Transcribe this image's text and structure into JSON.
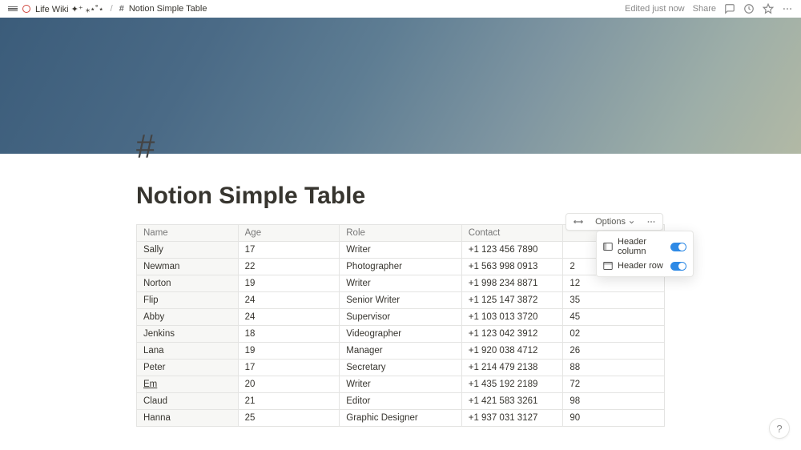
{
  "topbar": {
    "workspace": "Life Wiki ✦⁺ ⁎⋆˚⋆",
    "page": "Notion Simple Table",
    "edited": "Edited just now",
    "share": "Share"
  },
  "page": {
    "icon": "#",
    "title": "Notion Simple Table"
  },
  "toolbar": {
    "options": "Options"
  },
  "options_menu": {
    "header_column": "Header column",
    "header_row": "Header row"
  },
  "table": {
    "headers": [
      "Name",
      "Age",
      "Role",
      "Contact",
      ""
    ],
    "rows": [
      {
        "name": "Sally",
        "age": "17",
        "role": "Writer",
        "contact": "+1 123 456 7890",
        "extra": ""
      },
      {
        "name": "Newman",
        "age": "22",
        "role": "Photographer",
        "contact": "+1 563 998 0913",
        "extra": "2"
      },
      {
        "name": "Norton",
        "age": "19",
        "role": "Writer",
        "contact": "+1 998 234 8871",
        "extra": "12"
      },
      {
        "name": "Flip",
        "age": "24",
        "role": "Senior Writer",
        "contact": "+1 125 147 3872",
        "extra": "35"
      },
      {
        "name": "Abby",
        "age": "24",
        "role": "Supervisor",
        "contact": "+1 103 013 3720",
        "extra": "45"
      },
      {
        "name": "Jenkins",
        "age": "18",
        "role": "Videographer",
        "contact": "+1 123 042 3912",
        "extra": "02"
      },
      {
        "name": "Lana",
        "age": "19",
        "role": "Manager",
        "contact": "+1 920 038 4712",
        "extra": "26"
      },
      {
        "name": "Peter",
        "age": "17",
        "role": "Secretary",
        "contact": "+1 214 479 2138",
        "extra": "88"
      },
      {
        "name": "Em",
        "age": "20",
        "role": "Writer",
        "contact": "+1 435 192 2189",
        "extra": "72"
      },
      {
        "name": "Claud",
        "age": "21",
        "role": "Editor",
        "contact": "+1 421 583 3261",
        "extra": "98"
      },
      {
        "name": "Hanna",
        "age": "25",
        "role": "Graphic Designer",
        "contact": "+1 937 031 3127",
        "extra": "90"
      }
    ]
  },
  "help": "?"
}
